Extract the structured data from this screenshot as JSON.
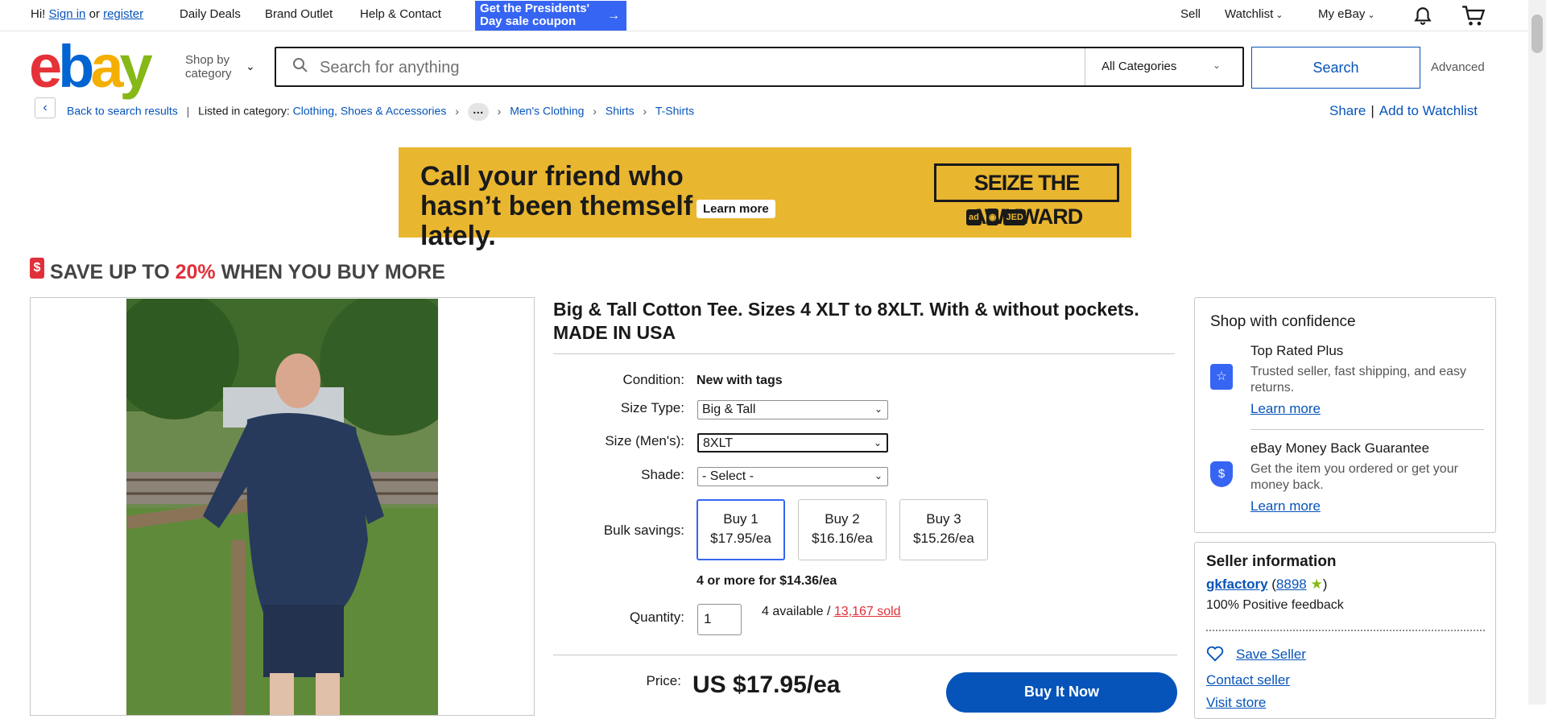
{
  "topnav": {
    "greeting_hi": "Hi!",
    "sign_in": "Sign in",
    "or": "or",
    "register": "register",
    "daily_deals": "Daily Deals",
    "brand_outlet": "Brand Outlet",
    "help_contact": "Help & Contact",
    "promo": "Get the Presidents' Day sale coupon",
    "sell": "Sell",
    "watchlist": "Watchlist",
    "my_ebay": "My eBay"
  },
  "header": {
    "logo": [
      "e",
      "b",
      "a",
      "y"
    ],
    "shop_by_line1": "Shop by",
    "shop_by_line2": "category",
    "search_placeholder": "Search for anything",
    "category": "All Categories",
    "search_button": "Search",
    "advanced": "Advanced"
  },
  "breadcrumb": {
    "back": "Back to search results",
    "listed_in": "Listed in category:",
    "items": [
      "Clothing, Shoes & Accessories",
      "Men's Clothing",
      "Shirts",
      "T-Shirts"
    ],
    "share": "Share",
    "add_watchlist": "Add to Watchlist"
  },
  "ad": {
    "headline": "Call your friend who hasn’t been themself lately.",
    "learn_more": "Learn more",
    "campaign": "SEIZE THE AWKWARD",
    "orgs": [
      "ad",
      "JED"
    ]
  },
  "save_banner": {
    "prefix": "SAVE UP TO",
    "percent": "20%",
    "suffix": "WHEN YOU BUY MORE"
  },
  "product": {
    "title": "Big & Tall Cotton Tee. Sizes 4 XLT to 8XLT. With & without pockets. MADE IN USA",
    "condition_label": "Condition:",
    "condition_value": "New with tags",
    "size_type_label": "Size Type:",
    "size_type_value": "Big & Tall",
    "size_label": "Size (Men's):",
    "size_value": "8XLT",
    "shade_label": "Shade:",
    "shade_value": "- Select -",
    "bulk_label": "Bulk savings:",
    "bulk_options": [
      {
        "qty": "Buy 1",
        "price": "$17.95/ea"
      },
      {
        "qty": "Buy 2",
        "price": "$16.16/ea"
      },
      {
        "qty": "Buy 3",
        "price": "$15.26/ea"
      }
    ],
    "bulk_more": "4 or more for $14.36/ea",
    "quantity_label": "Quantity:",
    "quantity_value": "1",
    "available": "4 available /",
    "sold": "13,167 sold",
    "price_label": "Price:",
    "price": "US $17.95/ea",
    "buy_now": "Buy It Now"
  },
  "confidence": {
    "title": "Shop with confidence",
    "features": [
      {
        "title": "Top Rated Plus",
        "desc": "Trusted seller, fast shipping, and easy returns.",
        "link": "Learn more"
      },
      {
        "title": "eBay Money Back Guarantee",
        "desc": "Get the item you ordered or get your money back.",
        "link": "Learn more"
      }
    ]
  },
  "seller": {
    "title": "Seller information",
    "name": "gkfactory",
    "score": "8898",
    "feedback": "100% Positive feedback",
    "save_seller": "Save Seller",
    "contact": "Contact seller",
    "visit_store": "Visit store"
  },
  "colors": {
    "accent_blue": "#3665f3",
    "link_blue": "#0654ba",
    "sale_red": "#e0303a",
    "ad_yellow": "#e9b630"
  }
}
